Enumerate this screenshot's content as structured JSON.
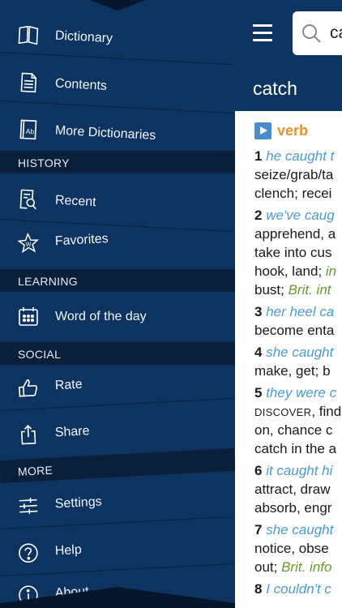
{
  "menu": {
    "items_top": [
      {
        "label": "Dictionary",
        "icon": "book-icon"
      },
      {
        "label": "Contents",
        "icon": "document-icon"
      },
      {
        "label": "More Dictionaries",
        "icon": "dictionary-ab-icon"
      }
    ],
    "sections": [
      {
        "title": "HISTORY",
        "items": [
          {
            "label": "Recent",
            "icon": "recent-search-icon"
          },
          {
            "label": "Favorites",
            "icon": "star-icon"
          }
        ]
      },
      {
        "title": "LEARNING",
        "items": [
          {
            "label": "Word of the day",
            "icon": "calendar-icon"
          }
        ]
      },
      {
        "title": "SOCIAL",
        "items": [
          {
            "label": "Rate",
            "icon": "thumbs-up-icon"
          },
          {
            "label": "Share",
            "icon": "share-icon"
          }
        ]
      },
      {
        "title": "MORE",
        "items": [
          {
            "label": "Settings",
            "icon": "sliders-icon"
          },
          {
            "label": "Help",
            "icon": "help-icon"
          },
          {
            "label": "About",
            "icon": "info-icon"
          }
        ]
      }
    ]
  },
  "header": {
    "search_value": "ca",
    "word": "catch"
  },
  "entry": {
    "part_of_speech": "verb",
    "senses": [
      {
        "num": "1",
        "lines": [
          [
            {
              "t": "ex",
              "v": "he caught t"
            }
          ],
          [
            {
              "t": "n",
              "v": "seize/grab/ta"
            }
          ],
          [
            {
              "t": "n",
              "v": "clench; recei"
            }
          ]
        ]
      },
      {
        "num": "2",
        "lines": [
          [
            {
              "t": "ex",
              "v": "we've caug"
            }
          ],
          [
            {
              "t": "n",
              "v": "apprehend, a"
            }
          ],
          [
            {
              "t": "n",
              "v": "take into cus"
            }
          ],
          [
            {
              "t": "n",
              "v": "hook, land; "
            },
            {
              "t": "reg",
              "v": "in"
            }
          ],
          [
            {
              "t": "n",
              "v": "bust; "
            },
            {
              "t": "reg",
              "v": "Brit. int"
            }
          ]
        ]
      },
      {
        "num": "3",
        "lines": [
          [
            {
              "t": "ex",
              "v": "her heel ca"
            }
          ],
          [
            {
              "t": "n",
              "v": "become enta"
            }
          ]
        ]
      },
      {
        "num": "4",
        "lines": [
          [
            {
              "t": "ex",
              "v": "she caught"
            }
          ],
          [
            {
              "t": "n",
              "v": "make, get; b"
            }
          ]
        ]
      },
      {
        "num": "5",
        "lines": [
          [
            {
              "t": "ex",
              "v": "they were c"
            }
          ],
          [
            {
              "t": "sc",
              "v": "DISCOVER"
            },
            {
              "t": "n",
              "v": ", find"
            }
          ],
          [
            {
              "t": "n",
              "v": "on, chance c"
            }
          ],
          [
            {
              "t": "n",
              "v": "catch in the a"
            }
          ]
        ]
      },
      {
        "num": "6",
        "lines": [
          [
            {
              "t": "ex",
              "v": "it caught hi"
            }
          ],
          [
            {
              "t": "n",
              "v": "attract, draw"
            }
          ],
          [
            {
              "t": "n",
              "v": "absorb, engr"
            }
          ]
        ]
      },
      {
        "num": "7",
        "lines": [
          [
            {
              "t": "ex",
              "v": "she caught"
            }
          ],
          [
            {
              "t": "n",
              "v": "notice, obse"
            }
          ],
          [
            {
              "t": "n",
              "v": "out; "
            },
            {
              "t": "reg",
              "v": "Brit. info"
            }
          ]
        ]
      },
      {
        "num": "8",
        "lines": [
          [
            {
              "t": "ex",
              "v": "I couldn't c"
            }
          ]
        ]
      }
    ]
  },
  "colors": {
    "menu_bg": "#0d3360",
    "section_bg": "#0a1f3a",
    "example": "#4b9bd3",
    "register": "#6a9a2f",
    "pos": "#e8902b"
  }
}
